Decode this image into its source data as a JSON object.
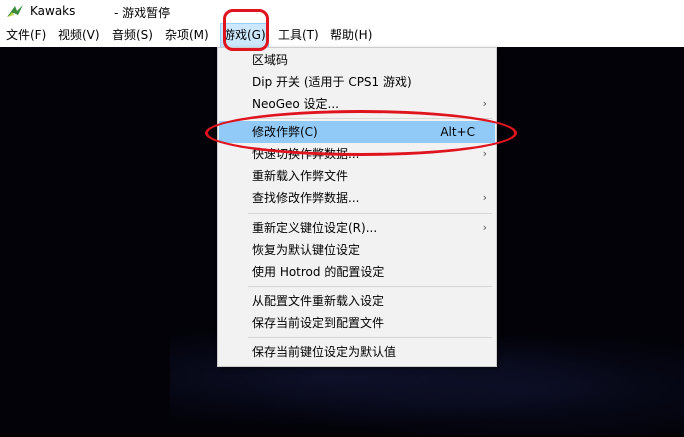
{
  "window": {
    "app_name": "Kawaks",
    "state": "- 游戏暂停",
    "icon": "kawaks-bird-icon"
  },
  "menubar": {
    "items": [
      {
        "label": "文件(F)",
        "active": false
      },
      {
        "label": "视频(V)",
        "active": false
      },
      {
        "label": "音频(S)",
        "active": false
      },
      {
        "label": "杂项(M)",
        "active": false
      },
      {
        "label": "游戏(G)",
        "active": true
      },
      {
        "label": "工具(T)",
        "active": false
      },
      {
        "label": "帮助(H)",
        "active": false
      }
    ]
  },
  "game_menu": {
    "items": [
      {
        "label": "区域码"
      },
      {
        "label": "Dip 开关 (适用于 CPS1 游戏)"
      },
      {
        "label": "NeoGeo 设定...",
        "submenu": true
      },
      {
        "label": "修改作弊(C)",
        "shortcut": "Alt+C",
        "highlighted": true
      },
      {
        "label": "快速切换作弊数据...",
        "submenu": true
      },
      {
        "label": "重新载入作弊文件"
      },
      {
        "label": "查找修改作弊数据...",
        "submenu": true
      },
      {
        "label": "重新定义键位设定(R)...",
        "submenu": true
      },
      {
        "label": "恢复为默认键位设定"
      },
      {
        "label": "使用 Hotrod 的配置设定"
      },
      {
        "label": "从配置文件重新载入设定"
      },
      {
        "label": "保存当前设定到配置文件"
      },
      {
        "label": "保存当前键位设定为默认值"
      }
    ],
    "submenu_arrow": "›"
  },
  "colors": {
    "highlight": "#91c9f7",
    "annotation_red": "#e0141e",
    "menubar_active": "#cce8ff"
  }
}
